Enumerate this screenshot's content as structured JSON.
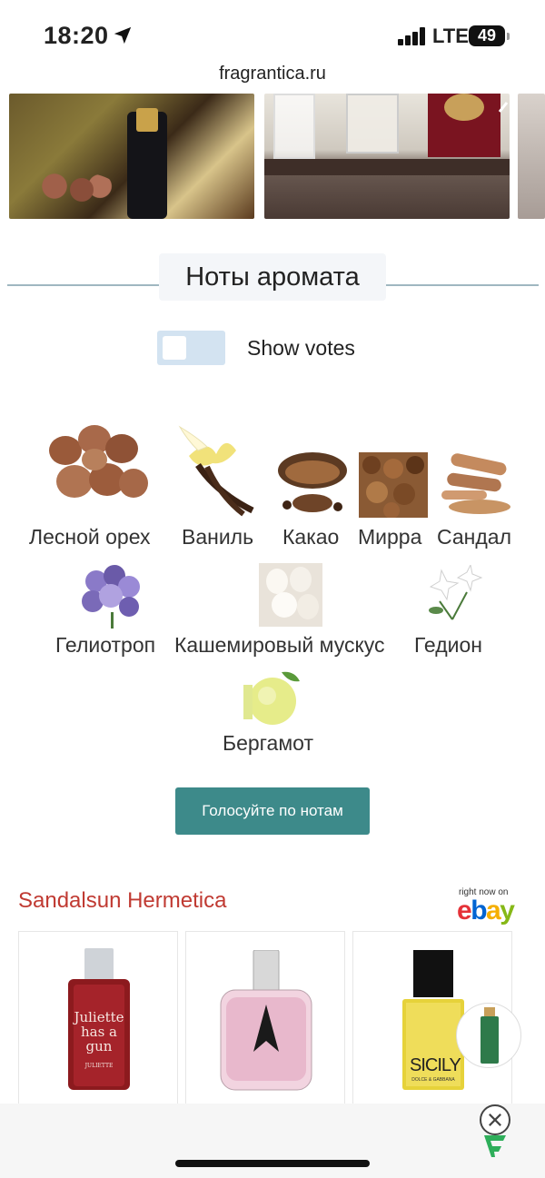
{
  "status_bar": {
    "time": "18:20",
    "network": "LTE",
    "battery": "49"
  },
  "browser": {
    "url": "fragrantica.ru"
  },
  "notes_section": {
    "title": "Ноты аромата",
    "toggle_label": "Show votes",
    "notes": [
      {
        "label": "Лесной орех",
        "icon": "hazelnut-icon"
      },
      {
        "label": "Ваниль",
        "icon": "vanilla-icon"
      },
      {
        "label": "Какао",
        "icon": "cocoa-icon"
      },
      {
        "label": "Мирра",
        "icon": "myrrh-icon"
      },
      {
        "label": "Сандал",
        "icon": "sandalwood-icon"
      },
      {
        "label": "Гелиотроп",
        "icon": "heliotrope-icon"
      },
      {
        "label": "Кашемировый мускус",
        "icon": "cashmere-musk-icon"
      },
      {
        "label": "Гедион",
        "icon": "hedione-icon"
      },
      {
        "label": "Бергамот",
        "icon": "bergamot-icon"
      }
    ],
    "vote_button": "Голосуйте по нотам"
  },
  "shop": {
    "title": "Sandalsun Hermetica",
    "ebay_caption": "right now on",
    "ebay_logo": [
      "e",
      "b",
      "a",
      "y"
    ],
    "products": [
      {
        "label_line1": "Juliette",
        "label_line2": "has a gun",
        "small": "JULIETTE"
      },
      {
        "label_line1": "",
        "label_line2": "",
        "small": ""
      },
      {
        "label_line1": "SICILY",
        "label_line2": "",
        "small": "DOLCE & GABBANA"
      }
    ]
  },
  "colors": {
    "accent_teal": "#3d8a8a",
    "shop_title_red": "#c03a32",
    "toggle_bg": "#d3e3f1"
  }
}
